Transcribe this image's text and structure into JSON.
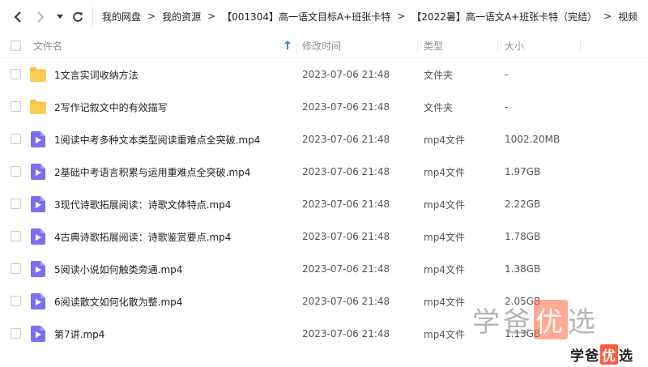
{
  "nav": {
    "back_icon": "chevron-left-icon",
    "forward_icon": "chevron-right-icon",
    "dropdown_icon": "caret-down-icon",
    "refresh_icon": "refresh-icon"
  },
  "breadcrumb": [
    "我的网盘",
    "我的资源",
    "【001304】高一语文目标A+班张卡特",
    "【2022暑】高一语文A+班张卡特（完结）",
    "视频"
  ],
  "breadcrumb_sep": ">",
  "header": {
    "name": "文件名",
    "modified": "修改时间",
    "type": "类型",
    "size": "大小",
    "sort_icon": "sort-ascending-arrow-icon"
  },
  "colors": {
    "folder": "#f8c33f",
    "video": "#7b6ff0",
    "sort_arrow": "#2a8cf0"
  },
  "rows": [
    {
      "kind": "folder",
      "icon": "folder-icon",
      "name": "1文言实词收纳方法",
      "time": "2023-07-06 21:48",
      "type": "文件夹",
      "size": "-"
    },
    {
      "kind": "folder",
      "icon": "folder-icon",
      "name": "2写作记叙文中的有效描写",
      "time": "2023-07-06 21:48",
      "type": "文件夹",
      "size": "-"
    },
    {
      "kind": "video",
      "icon": "video-file-icon",
      "name": "1阅读中考多种文本类型阅读重难点全突破.mp4",
      "time": "2023-07-06 21:48",
      "type": "mp4文件",
      "size": "1002.20MB"
    },
    {
      "kind": "video",
      "icon": "video-file-icon",
      "name": "2基础中考语言积累与运用重难点全突破.mp4",
      "time": "2023-07-06 21:48",
      "type": "mp4文件",
      "size": "1.97GB"
    },
    {
      "kind": "video",
      "icon": "video-file-icon",
      "name": "3现代诗歌拓展阅读：诗歌文体特点.mp4",
      "time": "2023-07-06 21:48",
      "type": "mp4文件",
      "size": "2.22GB"
    },
    {
      "kind": "video",
      "icon": "video-file-icon",
      "name": "4古典诗歌拓展阅读：诗歌鉴赏要点.mp4",
      "time": "2023-07-06 21:48",
      "type": "mp4文件",
      "size": "1.78GB"
    },
    {
      "kind": "video",
      "icon": "video-file-icon",
      "name": "5阅读小说如何触类旁通.mp4",
      "time": "2023-07-06 21:48",
      "type": "mp4文件",
      "size": "1.38GB"
    },
    {
      "kind": "video",
      "icon": "video-file-icon",
      "name": "6阅读散文如何化散为整.mp4",
      "time": "2023-07-06 21:48",
      "type": "mp4文件",
      "size": "2.05GB"
    },
    {
      "kind": "video",
      "icon": "video-file-icon",
      "name": "第7讲.mp4",
      "time": "2023-07-06 21:48",
      "type": "mp4文件",
      "size": "1.13GB"
    }
  ],
  "watermark": {
    "pre": "学爸",
    "highlight": "优",
    "post": "选"
  },
  "brand": {
    "pre": "学爸",
    "highlight": "优",
    "post": "选"
  }
}
